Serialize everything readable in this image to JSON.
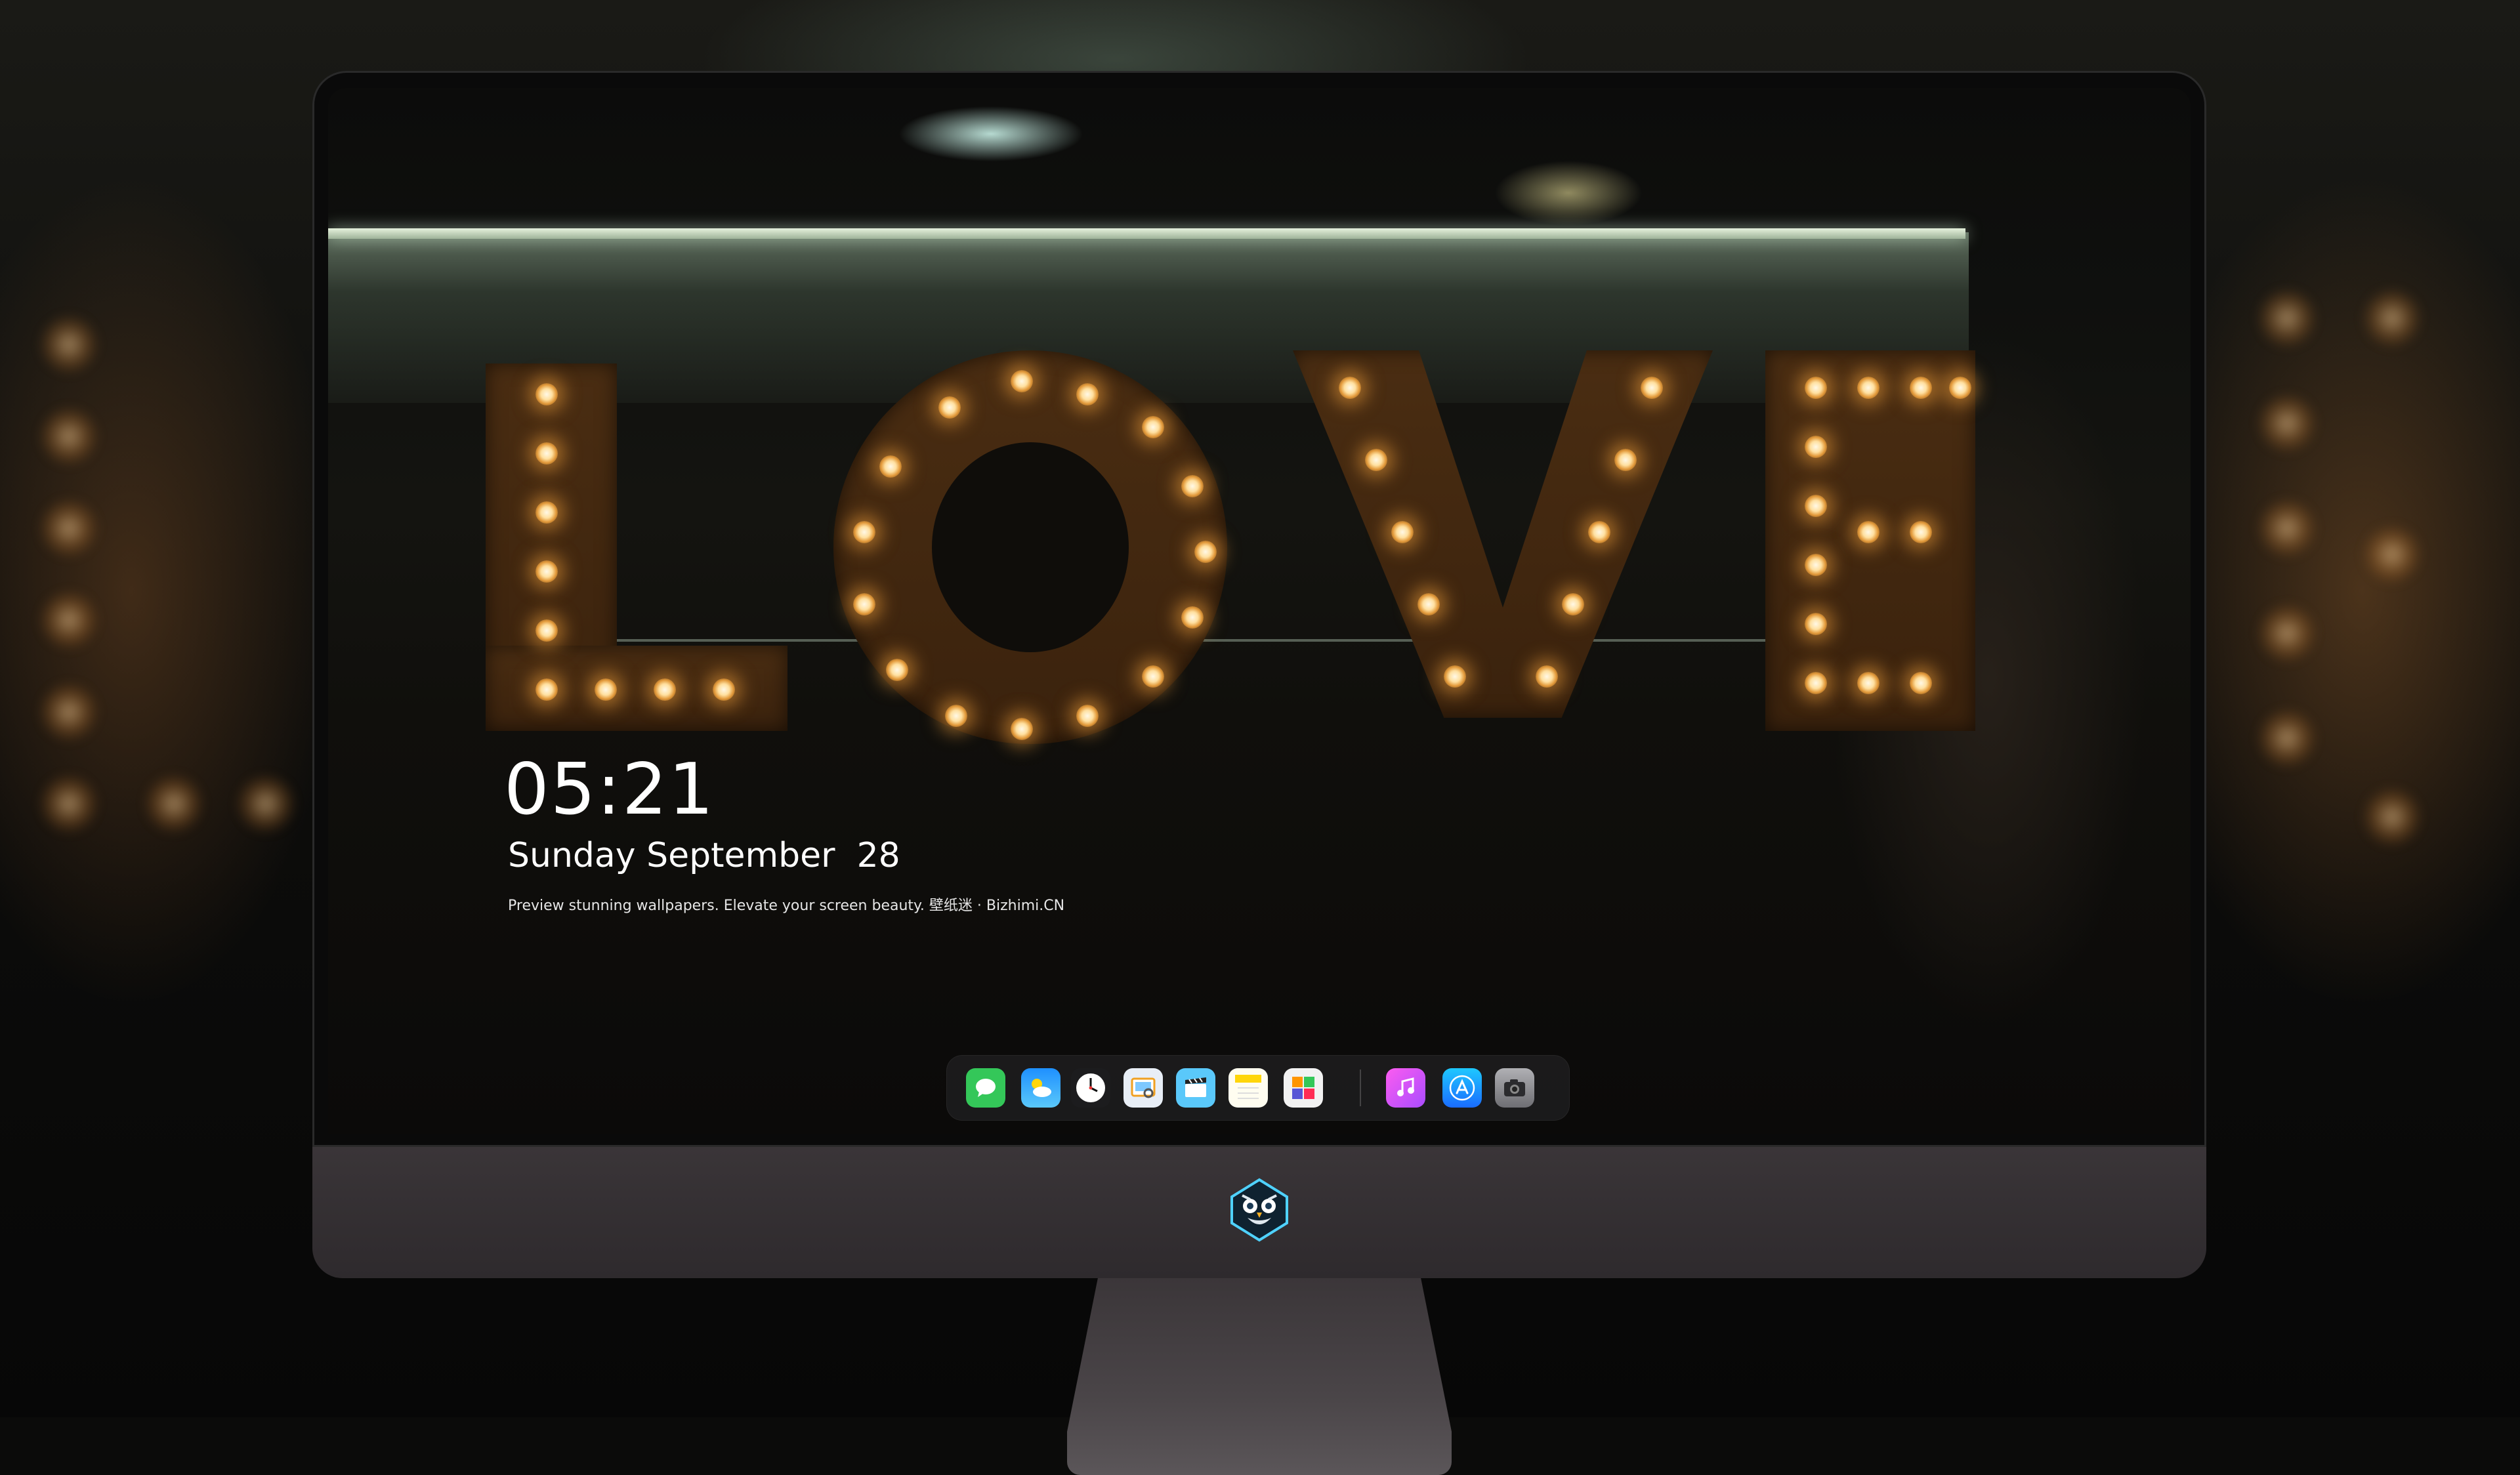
{
  "lock_screen": {
    "time": "05:21",
    "date": "Sunday September  28",
    "tagline": "Preview stunning wallpapers. Elevate your screen beauty. 壁纸迷 · Bizhimi.CN"
  },
  "dock": {
    "apps": [
      {
        "name": "messages-icon",
        "color": "#34c759"
      },
      {
        "name": "weather-icon",
        "color": "#1e90ff"
      },
      {
        "name": "clock-icon",
        "color": "#1c1c1e"
      },
      {
        "name": "preview-icon",
        "color": "#e8eef6"
      },
      {
        "name": "claquette-icon",
        "color": "#5ac8fa"
      },
      {
        "name": "notes-icon",
        "color": "#ffd60a"
      },
      {
        "name": "photo-board-icon",
        "color": "#f2f2f2"
      },
      {
        "name": "music-icon",
        "color": "#fc5cf0"
      },
      {
        "name": "app-store-icon",
        "color": "#1a8cff"
      },
      {
        "name": "camera-icon",
        "color": "#8e8e93"
      }
    ]
  },
  "branding": {
    "logo": "owl-mascot-logo"
  }
}
